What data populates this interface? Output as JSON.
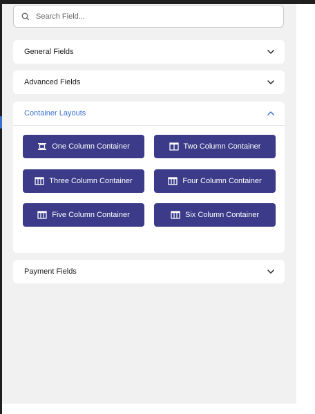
{
  "search": {
    "placeholder": "Search Field..."
  },
  "sections": {
    "general": {
      "label": "General Fields",
      "expanded": false
    },
    "advanced": {
      "label": "Advanced Fields",
      "expanded": false
    },
    "container": {
      "label": "Container Layouts",
      "expanded": true,
      "buttons": [
        {
          "label": "One Column Container",
          "icon": "one-column-icon"
        },
        {
          "label": "Two Column Container",
          "icon": "two-column-icon"
        },
        {
          "label": "Three Column Container",
          "icon": "multi-column-icon"
        },
        {
          "label": "Four Column Container",
          "icon": "multi-column-icon"
        },
        {
          "label": "Five Column Container",
          "icon": "multi-column-icon"
        },
        {
          "label": "Six Column Container",
          "icon": "multi-column-icon"
        }
      ]
    },
    "payment": {
      "label": "Payment Fields",
      "expanded": false
    }
  },
  "colors": {
    "button_bg": "#3b3b8a",
    "active_title": "#3a6fd0",
    "panel_bg": "#f1f1f1"
  }
}
